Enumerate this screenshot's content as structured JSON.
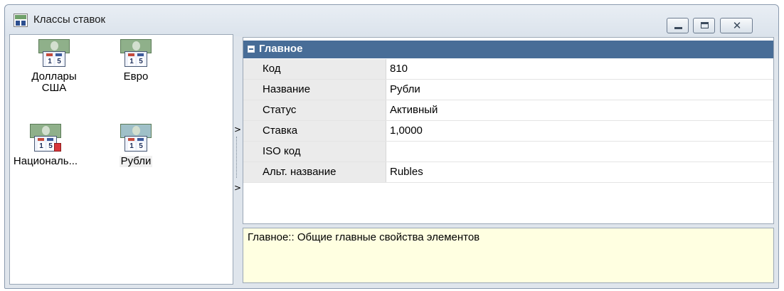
{
  "window": {
    "title": "Классы ставок",
    "buttons": {
      "minimize": "minimize-icon",
      "maximize": "maximize-icon",
      "close": "close-icon"
    },
    "close_glyph": "✕"
  },
  "list": {
    "items": [
      {
        "label": "Доллары США",
        "icon": "currency-class-icon",
        "selected": false,
        "warning": false
      },
      {
        "label": "Евро",
        "icon": "currency-class-icon",
        "selected": false,
        "warning": false
      },
      {
        "label": "Националь...",
        "icon": "currency-class-icon",
        "selected": false,
        "warning": true
      },
      {
        "label": "Рубли",
        "icon": "currency-class-icon",
        "selected": true,
        "warning": false
      }
    ]
  },
  "splitter": {
    "arrow_top": ">",
    "arrow_bottom": ">"
  },
  "properties": {
    "section_title": "Главное",
    "rows": [
      {
        "key": "Код",
        "value": "810"
      },
      {
        "key": "Название",
        "value": "Рубли"
      },
      {
        "key": "Статус",
        "value": "Активный"
      },
      {
        "key": "Ставка",
        "value": "1,0000"
      },
      {
        "key": "ISO код",
        "value": ""
      },
      {
        "key": "Альт. название",
        "value": "Rubles"
      }
    ]
  },
  "description": "Главное:: Общие главные свойства элементов",
  "colors": {
    "section_header": "#486d97",
    "description_bg": "#ffffe1",
    "key_column_bg": "#ebebeb"
  }
}
